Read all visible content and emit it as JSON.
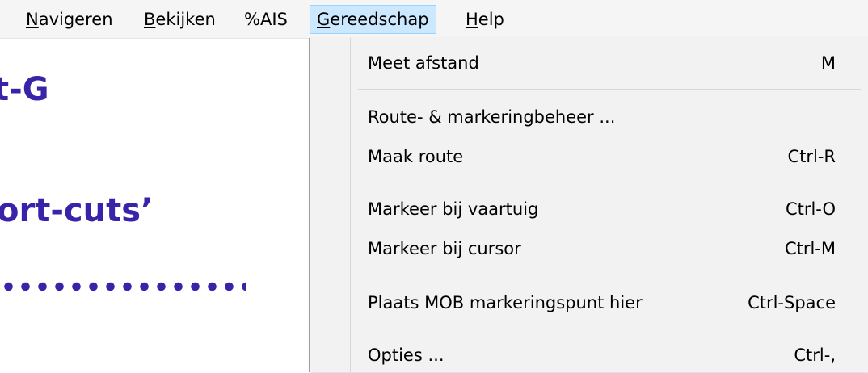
{
  "menubar": {
    "items": [
      {
        "accel": "N",
        "rest": "avigeren"
      },
      {
        "accel": "B",
        "rest": "ekijken"
      },
      {
        "accel": "",
        "rest": "%AIS"
      },
      {
        "accel": "G",
        "rest": "ereedschap"
      },
      {
        "accel": "H",
        "rest": "elp"
      }
    ]
  },
  "slide": {
    "line1": "t-G",
    "line2": "ort-cuts’"
  },
  "dropdown": {
    "items": [
      {
        "label": "Meet afstand",
        "shortcut": "M"
      },
      {
        "label": "Route- & markeringbeheer ...",
        "shortcut": ""
      },
      {
        "label": "Maak route",
        "shortcut": "Ctrl-R"
      },
      {
        "label": "Markeer bij vaartuig",
        "shortcut": "Ctrl-O"
      },
      {
        "label": "Markeer bij cursor",
        "shortcut": "Ctrl-M"
      },
      {
        "label": "Plaats MOB markeringspunt hier",
        "shortcut": "Ctrl-Space"
      },
      {
        "label": "Opties ...",
        "shortcut": "Ctrl-,"
      }
    ]
  },
  "colors": {
    "slide_text": "#3a23a8",
    "menu_active_bg": "#cce8ff",
    "menu_active_border": "#99d1ff"
  }
}
